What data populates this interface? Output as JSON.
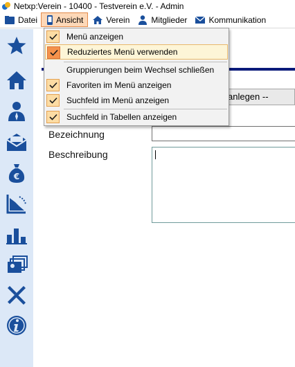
{
  "window": {
    "title": "Netxp:Verein - 10400 - Testverein e.V. - Admin"
  },
  "menubar": {
    "items": [
      {
        "label": "Datei",
        "icon": "folder-icon"
      },
      {
        "label": "Ansicht",
        "icon": "phone-icon",
        "active": true
      },
      {
        "label": "Verein",
        "icon": "home-icon"
      },
      {
        "label": "Mitglieder",
        "icon": "users-icon"
      },
      {
        "label": "Kommunikation",
        "icon": "mail-icon"
      }
    ]
  },
  "dropdown": {
    "items": [
      {
        "label": "Menü anzeigen",
        "checked": true
      },
      {
        "label": "Reduziertes Menü verwenden",
        "checked": true,
        "highlighted": true
      },
      {
        "label": "Gruppierungen beim Wechsel schließen",
        "checked": false
      },
      {
        "label": "Favoriten im Menü anzeigen",
        "checked": true
      },
      {
        "label": "Suchfeld im Menü anzeigen",
        "checked": true
      },
      {
        "label": "Suchfeld in Tabellen anzeigen",
        "checked": true
      }
    ]
  },
  "sidebar": {
    "icons": [
      "star-icon",
      "home-icon",
      "member-icon",
      "mail-icon",
      "money-bag-icon",
      "chart-trend-icon",
      "bar-chart-icon",
      "cards-icon",
      "tools-icon",
      "info-icon"
    ]
  },
  "form": {
    "combo_text": "anlegen --",
    "label_bezeichnung": "Bezeichnung",
    "label_beschreibung": "Beschreibung"
  },
  "colors": {
    "accent_blue": "#1a3a8f",
    "sidebar_bg": "#dce8f7",
    "active_menu": "#fdd8b8",
    "check_bg": "#fcdca4"
  }
}
